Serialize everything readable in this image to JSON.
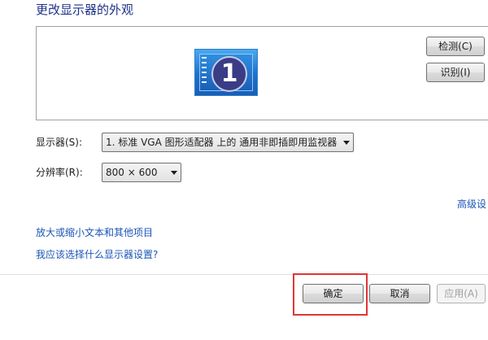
{
  "header": {
    "title": "更改显示器的外观"
  },
  "preview": {
    "monitor_number": "1",
    "detect_label": "检测(C)",
    "identify_label": "识别(I)"
  },
  "settings": {
    "display_label": "显示器(S):",
    "display_value": "1. 标准 VGA 图形适配器 上的 通用非即插即用监视器",
    "resolution_label": "分辨率(R):",
    "resolution_value": "800 × 600",
    "advanced_link": "高级设"
  },
  "links": {
    "enlarge_text": "放大或缩小文本和其他项目",
    "which_settings": "我应该选择什么显示器设置?"
  },
  "footer": {
    "ok_label": "确定",
    "cancel_label": "取消",
    "apply_label": "应用(A)"
  },
  "colors": {
    "title": "#1e3287",
    "link": "#1a55b5",
    "highlight": "#e03535"
  }
}
